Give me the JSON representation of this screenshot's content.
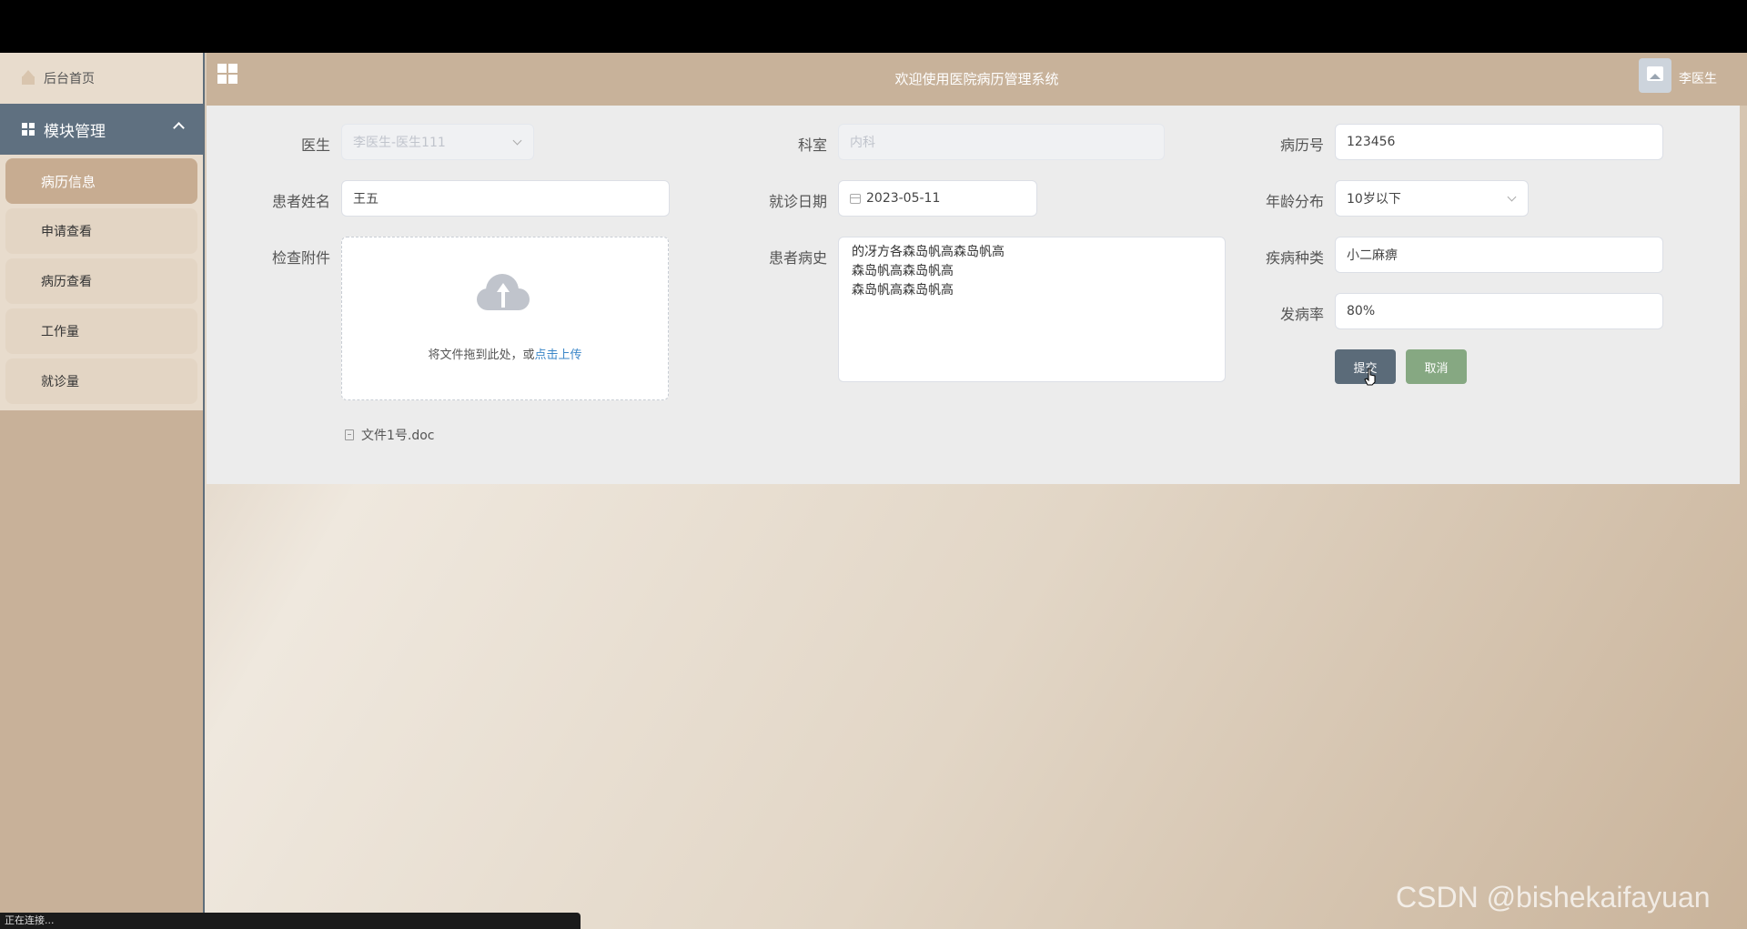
{
  "header": {
    "title": "欢迎使用医院病历管理系统",
    "username": "李医生"
  },
  "sidebar": {
    "home": "后台首页",
    "module": "模块管理",
    "items": [
      {
        "label": "病历信息",
        "active": true
      },
      {
        "label": "申请查看"
      },
      {
        "label": "病历查看"
      },
      {
        "label": "工作量"
      },
      {
        "label": "就诊量"
      }
    ]
  },
  "form": {
    "doctor": {
      "label": "医生",
      "value": "李医生-医生111"
    },
    "department": {
      "label": "科室",
      "placeholder": "内科"
    },
    "record_no": {
      "label": "病历号",
      "value": "123456"
    },
    "patient_name": {
      "label": "患者姓名",
      "value": "王五"
    },
    "visit_date": {
      "label": "就诊日期",
      "value": "2023-05-11"
    },
    "age_group": {
      "label": "年龄分布",
      "value": "10岁以下"
    },
    "attachment": {
      "label": "检查附件",
      "upload_text": "将文件拖到此处，或",
      "upload_link": "点击上传",
      "file_name": "文件1号.doc"
    },
    "history": {
      "label": "患者病史",
      "value": "的冴方各森岛帆高森岛帆高\n森岛帆高森岛帆高\n森岛帆高森岛帆高"
    },
    "disease_type": {
      "label": "疾病种类",
      "value": "小二麻痹"
    },
    "incidence": {
      "label": "发病率",
      "value": "80%"
    },
    "submit": "提交",
    "cancel": "取消"
  },
  "watermark": "CSDN @bishekaifayuan",
  "status_bar": "正在连接..."
}
